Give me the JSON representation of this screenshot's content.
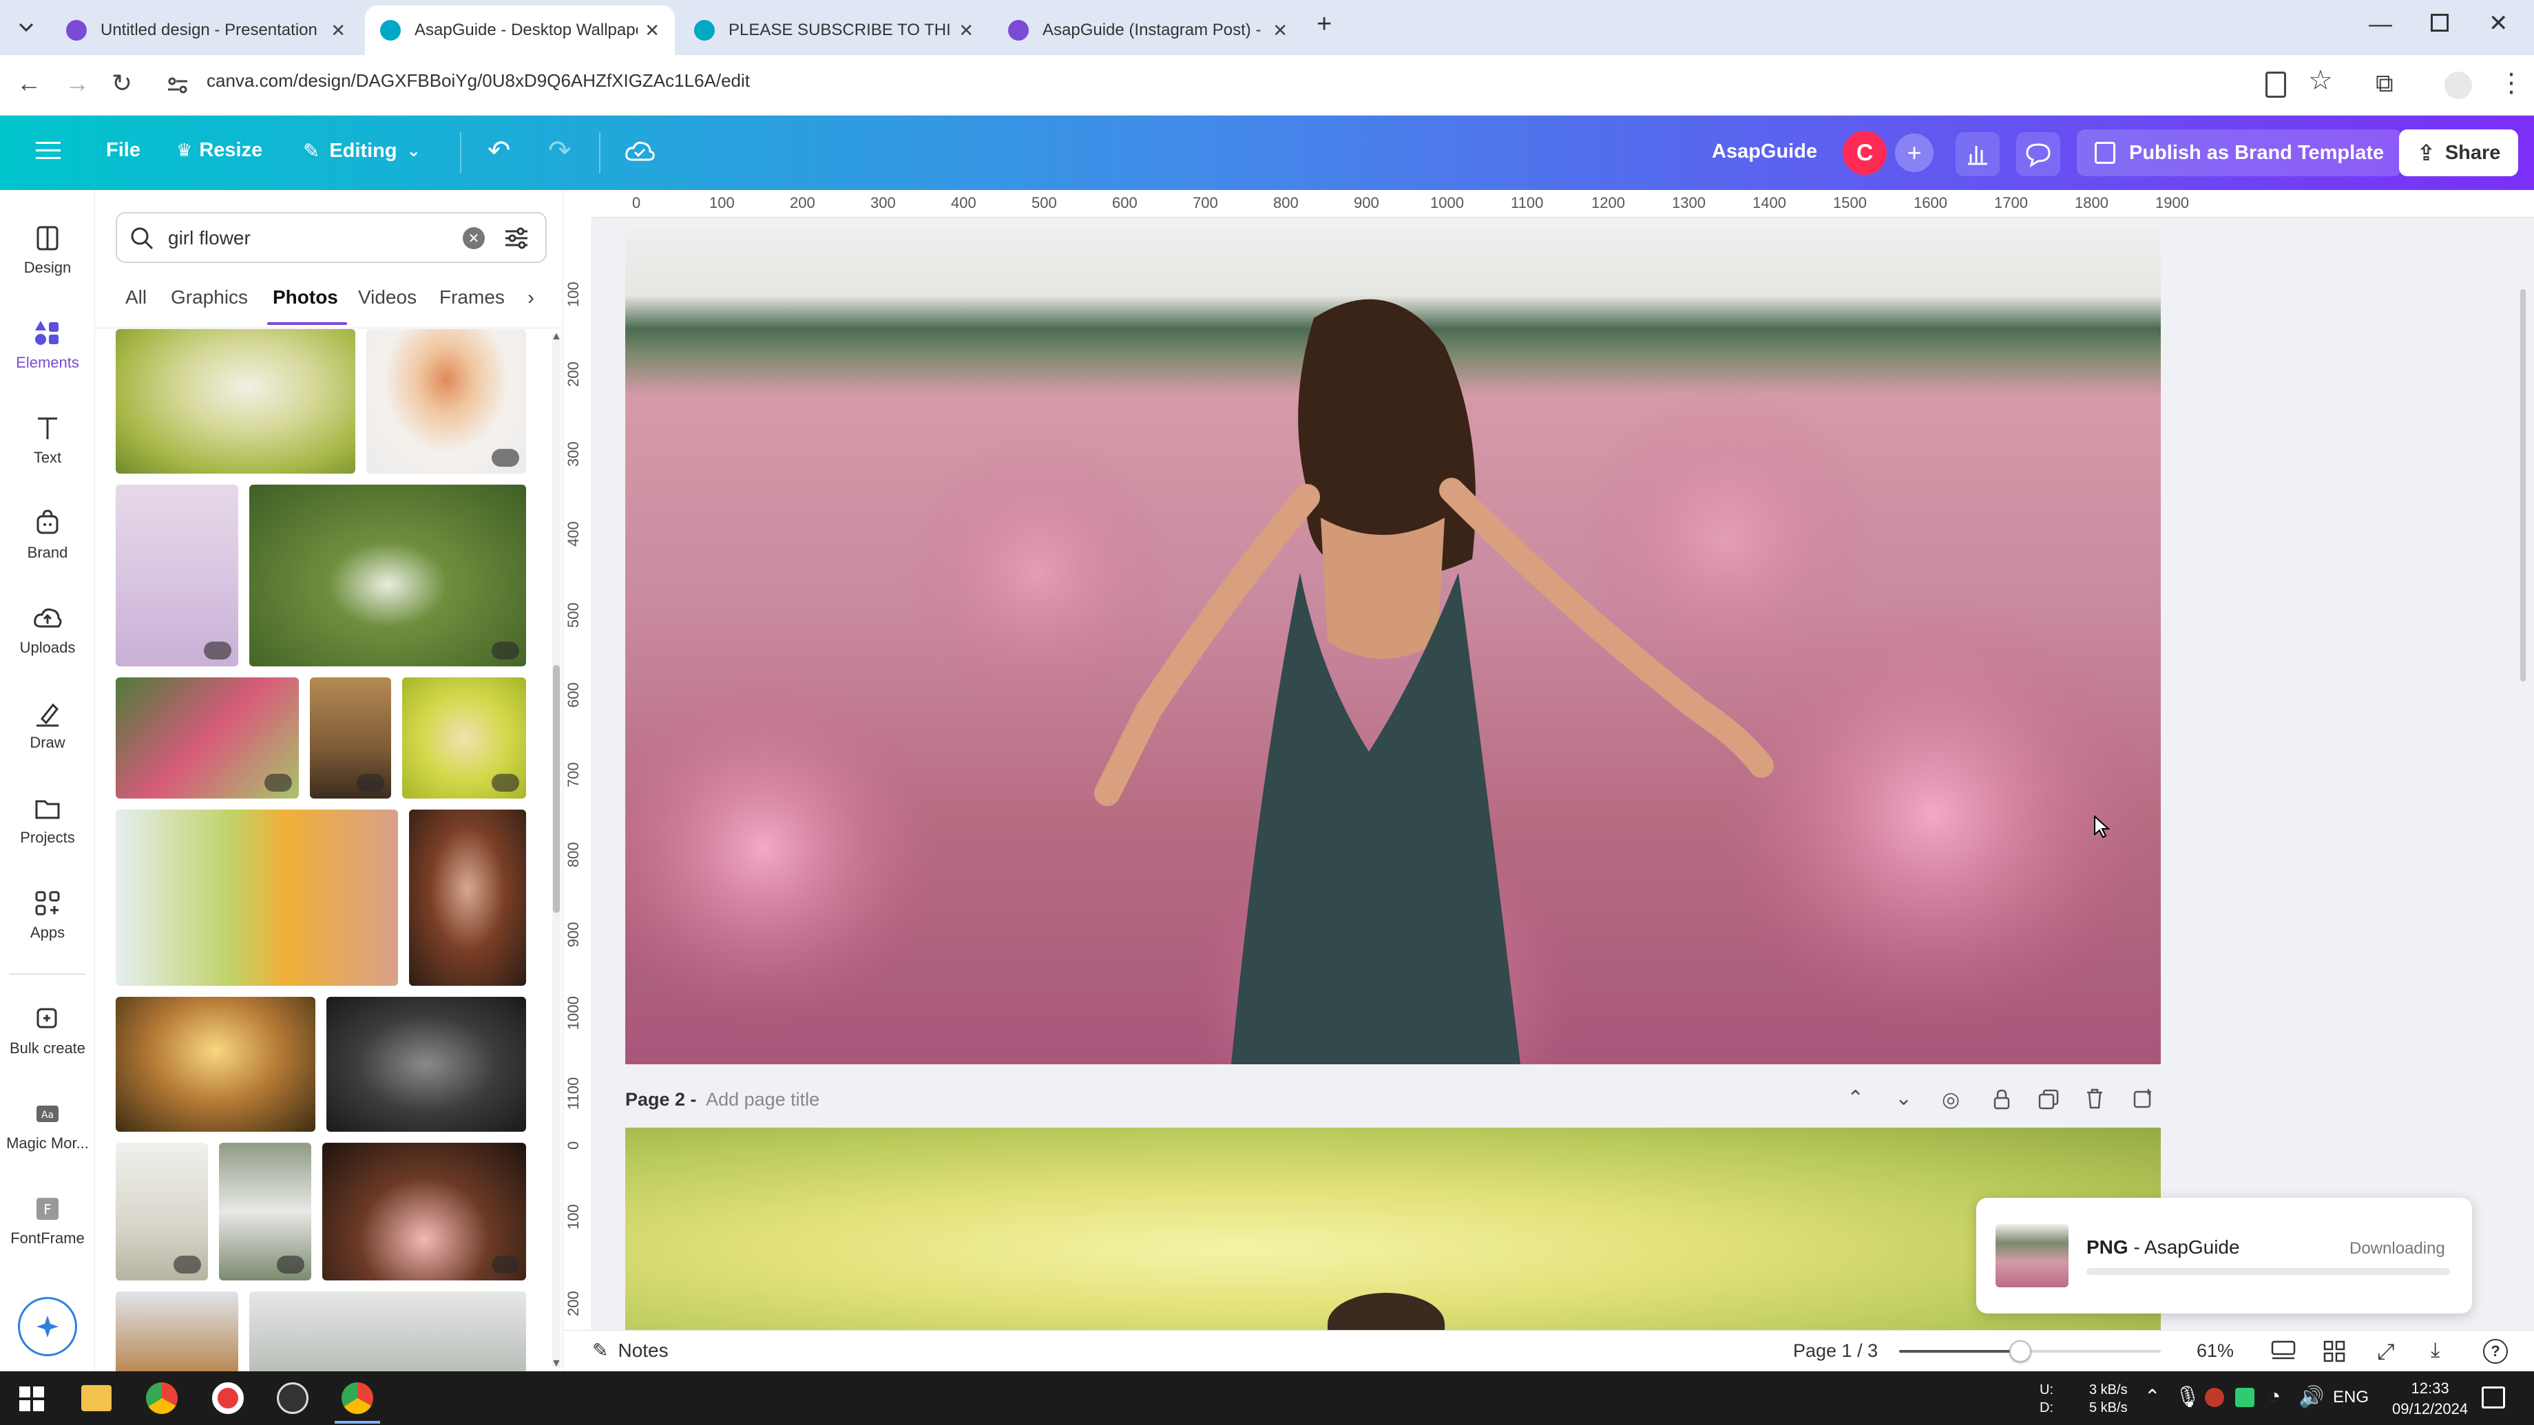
{
  "browser": {
    "tabs": [
      {
        "title": "Untitled design - Presentation",
        "favicon_color": "#7b4bd6"
      },
      {
        "title": "AsapGuide - Desktop Wallpaper",
        "favicon_color": "#00a8c6"
      },
      {
        "title": "PLEASE SUBSCRIBE TO THIS CH",
        "favicon_color": "#00a8c6"
      },
      {
        "title": "AsapGuide (Instagram Post) - Y",
        "favicon_color": "#7b4bd6"
      }
    ],
    "url": "canva.com/design/DAGXFBBoiYg/0U8xD9Q6AHZfXIGZAc1L6A/edit"
  },
  "header": {
    "file_label": "File",
    "resize_label": "Resize",
    "editing_label": "Editing",
    "brand_name": "AsapGuide",
    "avatar_letter": "C",
    "publish_label": "Publish as Brand Template",
    "share_label": "Share"
  },
  "rail": {
    "items": [
      {
        "label": "Design",
        "icon": "design-icon"
      },
      {
        "label": "Elements",
        "icon": "elements-icon"
      },
      {
        "label": "Text",
        "icon": "text-icon"
      },
      {
        "label": "Brand",
        "icon": "brand-icon"
      },
      {
        "label": "Uploads",
        "icon": "uploads-icon"
      },
      {
        "label": "Draw",
        "icon": "draw-icon"
      },
      {
        "label": "Projects",
        "icon": "projects-icon"
      },
      {
        "label": "Apps",
        "icon": "apps-icon"
      },
      {
        "label": "Bulk create",
        "icon": "bulk-create-icon"
      },
      {
        "label": "Magic Mor...",
        "icon": "magic-morph-icon"
      },
      {
        "label": "FontFrame",
        "icon": "fontframe-icon"
      }
    ]
  },
  "panel": {
    "search_value": "girl flower",
    "filter_tabs": [
      "All",
      "Graphics",
      "Photos",
      "Videos",
      "Frames"
    ],
    "active_tab": "Photos"
  },
  "ruler": {
    "top": [
      "0",
      "100",
      "200",
      "300",
      "400",
      "500",
      "600",
      "700",
      "800",
      "900",
      "1000",
      "1100",
      "1200",
      "1300",
      "1400",
      "1500",
      "1600",
      "1700",
      "1800",
      "1900"
    ],
    "left": [
      "100",
      "200",
      "300",
      "400",
      "500",
      "600",
      "700",
      "800",
      "900",
      "1000",
      "1100",
      "0",
      "100",
      "200"
    ]
  },
  "page2": {
    "label": "Page 2 -",
    "title_placeholder": "Add page title"
  },
  "toast": {
    "format": "PNG",
    "name": "- AsapGuide",
    "status": "Downloading"
  },
  "bottom": {
    "notes_label": "Notes",
    "page_indicator": "Page 1 / 3",
    "zoom": "61%"
  },
  "taskbar": {
    "net_up": "3 kB/s",
    "net_down": "5 kB/s",
    "net_u": "U:",
    "net_d": "D:",
    "lang": "ENG",
    "time": "12:33",
    "date": "09/12/2024"
  }
}
